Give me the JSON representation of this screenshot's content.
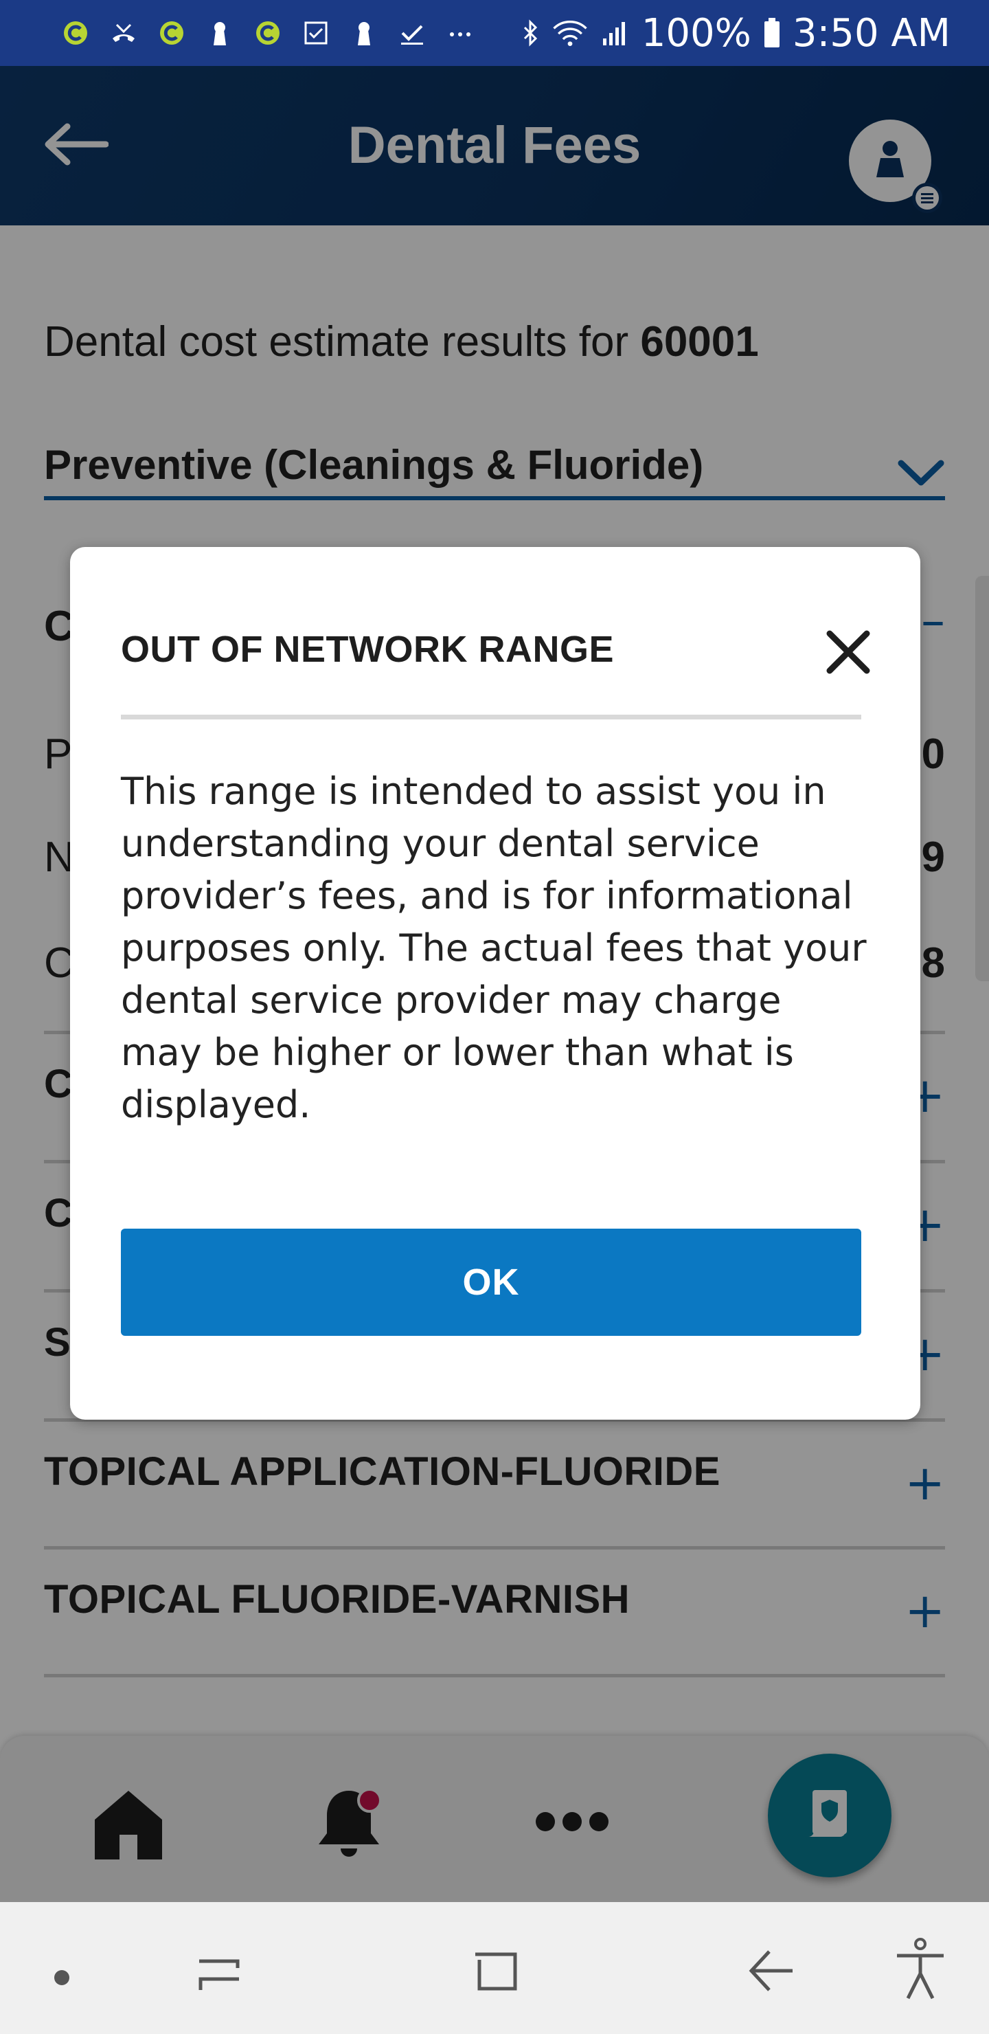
{
  "status_bar": {
    "battery": "100%",
    "time": "3:50 AM",
    "left_icons": [
      "app-c-icon",
      "missed-call-icon",
      "app-c-icon",
      "keyhole-icon",
      "app-c-icon",
      "checkbox-icon",
      "keyhole-icon",
      "download-done-icon",
      "more-dots-icon"
    ],
    "right_icons": [
      "bluetooth-icon",
      "wifi-icon",
      "signal-icon",
      "battery-icon"
    ]
  },
  "header": {
    "title": "Dental Fees"
  },
  "content": {
    "estimate_prefix": "Dental cost estimate results for",
    "zip_code": "60001",
    "category": "Preventive (Cleanings & Fluoride)",
    "peek_rows": [
      {
        "left": "C",
        "right": ""
      },
      {
        "left": "P",
        "right": "0"
      },
      {
        "left": "N",
        "right": "9"
      },
      {
        "left": "C",
        "right": "8"
      }
    ],
    "procedure_rows": [
      {
        "label": "C"
      },
      {
        "label": "C"
      },
      {
        "label": "S"
      },
      {
        "label": "TOPICAL APPLICATION-FLUORIDE"
      },
      {
        "label": "TOPICAL FLUORIDE-VARNISH"
      }
    ],
    "expand_symbol": "+",
    "collapse_symbol": "–"
  },
  "dialog": {
    "title": "OUT OF NETWORK RANGE",
    "body": "This range is intended to assist you in understanding your dental service provider’s fees, and is for informational purposes only. The actual fees that your dental service provider may charge may be higher or lower than what is displayed.",
    "ok_label": "OK"
  },
  "colors": {
    "accent": "#0b78c2",
    "header_bg": "#0b3361",
    "status_bar_bg": "#1b3a86",
    "fab_bg": "#0a7f95",
    "notification_dot": "#c4124a"
  }
}
